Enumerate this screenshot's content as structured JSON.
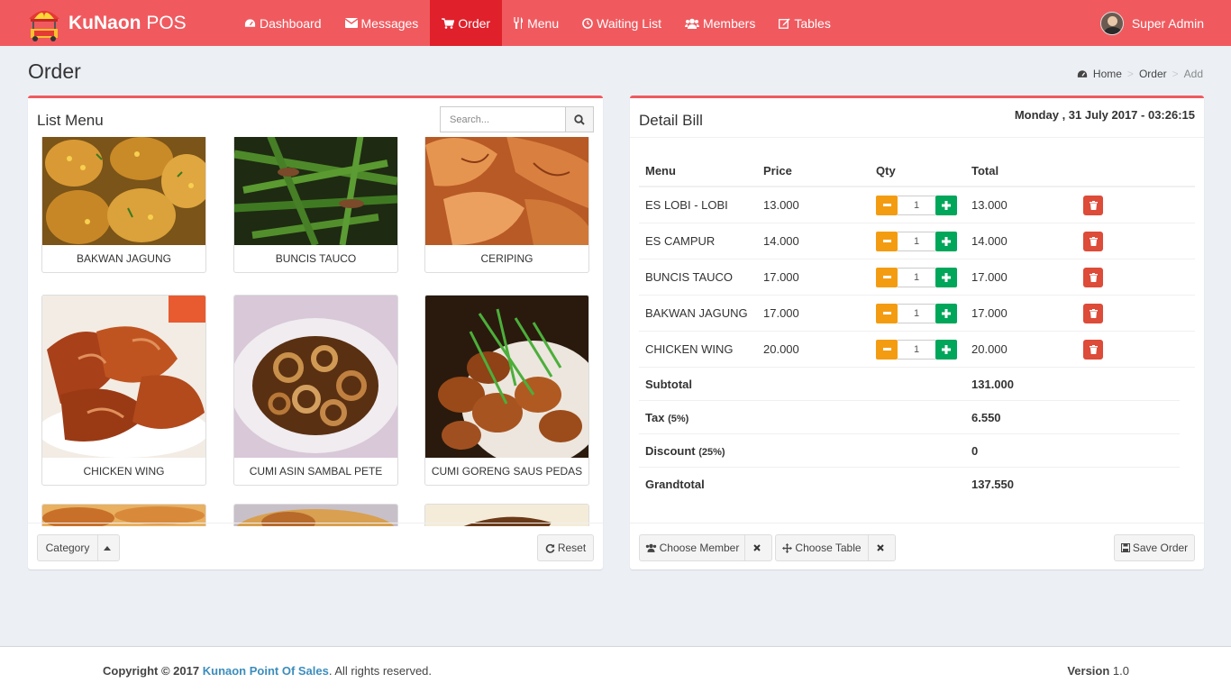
{
  "brand": {
    "bold": "KuNaon",
    "rest": " POS"
  },
  "nav": {
    "items": [
      {
        "label": "Dashboard",
        "icon": "dashboard-icon"
      },
      {
        "label": "Messages",
        "icon": "envelope-icon"
      },
      {
        "label": "Order",
        "icon": "cart-icon",
        "active": true
      },
      {
        "label": "Menu",
        "icon": "cutlery-icon"
      },
      {
        "label": "Waiting List",
        "icon": "clock-icon"
      },
      {
        "label": "Members",
        "icon": "users-icon"
      },
      {
        "label": "Tables",
        "icon": "edit-icon"
      }
    ],
    "user": "Super Admin"
  },
  "page": {
    "title": "Order",
    "breadcrumb": {
      "home": "Home",
      "section": "Order",
      "current": "Add"
    }
  },
  "list_menu": {
    "title": "List Menu",
    "search_placeholder": "Search...",
    "items": [
      {
        "name": "BAKWAN JAGUNG"
      },
      {
        "name": "BUNCIS TAUCO"
      },
      {
        "name": "CERIPING"
      },
      {
        "name": "CHICKEN WING"
      },
      {
        "name": "CUMI ASIN SAMBAL PETE"
      },
      {
        "name": "CUMI GORENG SAUS PEDAS"
      }
    ],
    "category_label": "Category",
    "reset_label": "Reset"
  },
  "bill": {
    "title": "Detail Bill",
    "date": "Monday , 31 July 2017 - 03:26:15",
    "headers": {
      "menu": "Menu",
      "price": "Price",
      "qty": "Qty",
      "total": "Total"
    },
    "rows": [
      {
        "menu": "ES LOBI - LOBI",
        "price": "13.000",
        "qty": "1",
        "total": "13.000"
      },
      {
        "menu": "ES CAMPUR",
        "price": "14.000",
        "qty": "1",
        "total": "14.000"
      },
      {
        "menu": "BUNCIS TAUCO",
        "price": "17.000",
        "qty": "1",
        "total": "17.000"
      },
      {
        "menu": "BAKWAN JAGUNG",
        "price": "17.000",
        "qty": "1",
        "total": "17.000"
      },
      {
        "menu": "CHICKEN WING",
        "price": "20.000",
        "qty": "1",
        "total": "20.000"
      }
    ],
    "subtotal_label": "Subtotal",
    "subtotal": "131.000",
    "tax_label": "Tax",
    "tax_rate": "(5%)",
    "tax": "6.550",
    "discount_label": "Discount",
    "discount_rate": "(25%)",
    "discount": "0",
    "grandtotal_label": "Grandtotal",
    "grandtotal": "137.550",
    "choose_member": "Choose Member",
    "choose_table": "Choose Table",
    "save_order": "Save Order"
  },
  "footer": {
    "copyright_prefix": "Copyright © 2017",
    "company": "Kunaon Point Of Sales",
    "suffix": ". All rights reserved.",
    "version_label": "Version",
    "version": "1.0"
  }
}
